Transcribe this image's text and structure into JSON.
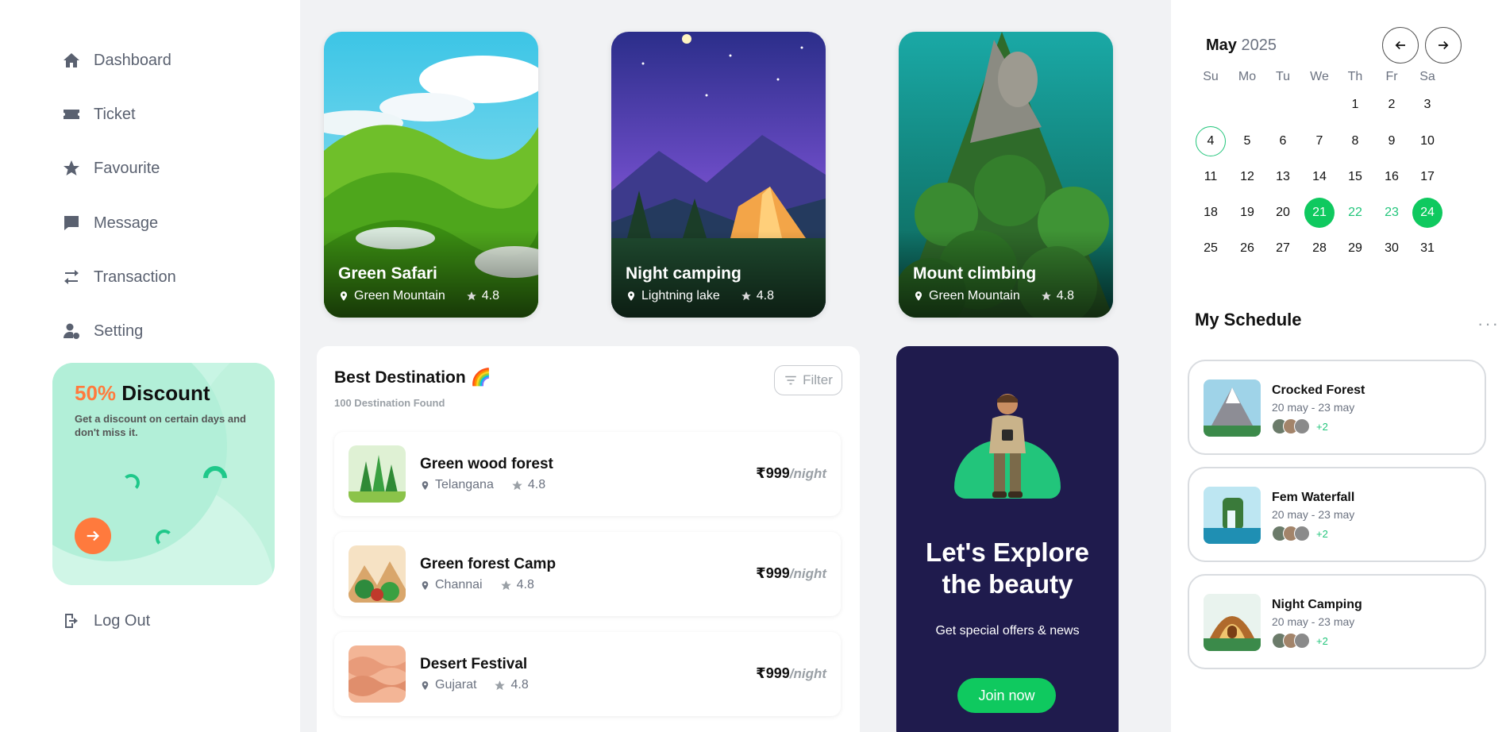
{
  "sidebar": {
    "items": [
      {
        "label": "Dashboard",
        "icon": "home-icon"
      },
      {
        "label": "Ticket",
        "icon": "ticket-icon"
      },
      {
        "label": "Favourite",
        "icon": "star-icon"
      },
      {
        "label": "Message",
        "icon": "message-icon"
      },
      {
        "label": "Transaction",
        "icon": "transfer-icon"
      },
      {
        "label": "Setting",
        "icon": "user-gear-icon"
      }
    ],
    "promo": {
      "percent": "50%",
      "title": " Discount",
      "text": "Get a discount on certain days and don't miss it."
    },
    "logout": "Log Out"
  },
  "cards": [
    {
      "title": "Green Safari",
      "location": "Green Mountain",
      "rating": "4.8"
    },
    {
      "title": "Night camping",
      "location": "Lightning lake",
      "rating": "4.8"
    },
    {
      "title": "Mount climbing",
      "location": "Green Mountain",
      "rating": "4.8"
    }
  ],
  "destinations": {
    "title": "Best Destination 🌈",
    "subtitle": "100 Destination Found",
    "filter": "Filter",
    "items": [
      {
        "name": "Green wood forest",
        "location": "Telangana",
        "rating": "4.8",
        "price": "₹999",
        "per": "/night"
      },
      {
        "name": "Green forest Camp",
        "location": "Channai",
        "rating": "4.8",
        "price": "₹999",
        "per": "/night"
      },
      {
        "name": "Desert Festival",
        "location": "Gujarat",
        "rating": "4.8",
        "price": "₹999",
        "per": "/night"
      }
    ]
  },
  "explore": {
    "title_line1": "Let's Explore",
    "title_line2": "the beauty",
    "subtitle": "Get special offers & news",
    "button": "Join now"
  },
  "calendar": {
    "month": "May",
    "year": "2025",
    "weekdays": [
      "Su",
      "Mo",
      "Tu",
      "We",
      "Th",
      "Fr",
      "Sa"
    ],
    "today": 4,
    "selected": [
      21,
      24
    ],
    "range": [
      22,
      23
    ]
  },
  "schedule": {
    "title": "My Schedule",
    "more": "···",
    "items": [
      {
        "name": "Crocked Forest",
        "dates": "20 may - 23 may",
        "extra": "+2"
      },
      {
        "name": "Fem Waterfall",
        "dates": "20 may - 23 may",
        "extra": "+2"
      },
      {
        "name": "Night Camping",
        "dates": "20 may - 23 may",
        "extra": "+2"
      }
    ]
  },
  "colors": {
    "accent": "#0fc95f",
    "promo_orange": "#ff7a3d",
    "explore_bg": "#1f1b4d"
  }
}
